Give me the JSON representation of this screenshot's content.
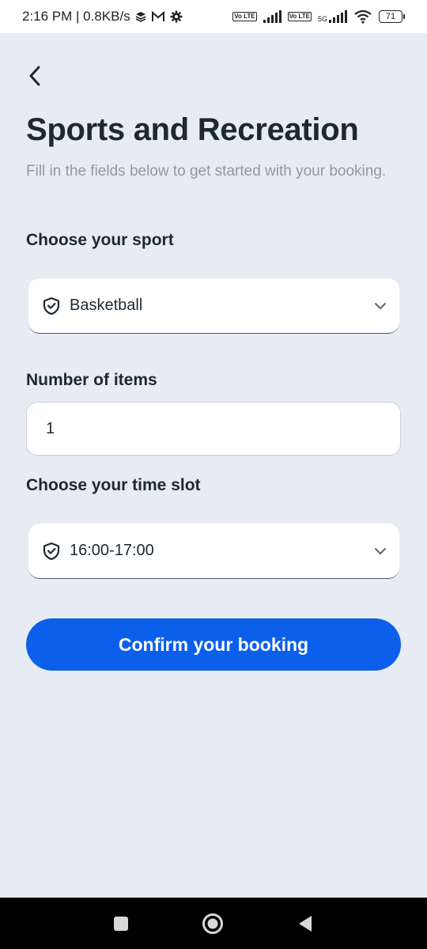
{
  "status_bar": {
    "time_speed": "2:16 PM | 0.8KB/s",
    "sim1_label": "Vo LTE",
    "sim2_label": "Vo LTE",
    "network_type": "5G",
    "battery_level": "71"
  },
  "header": {
    "title": "Sports and Recreation",
    "subtitle": "Fill in the fields below to get started with your booking."
  },
  "form": {
    "sport_label": "Choose your sport",
    "sport_value": "Basketball",
    "items_label": "Number of items",
    "items_value": "1",
    "timeslot_label": "Choose your time slot",
    "timeslot_value": "16:00-17:00",
    "confirm_label": "Confirm your booking"
  },
  "colors": {
    "background": "#e6ebf4",
    "accent": "#0b5fea",
    "title": "#1c2933",
    "subtitle": "#8f9aa3"
  },
  "icons": {
    "back": "chevron-left-icon",
    "select": "shield-check-icon",
    "dropdown": "chevron-down-icon"
  }
}
